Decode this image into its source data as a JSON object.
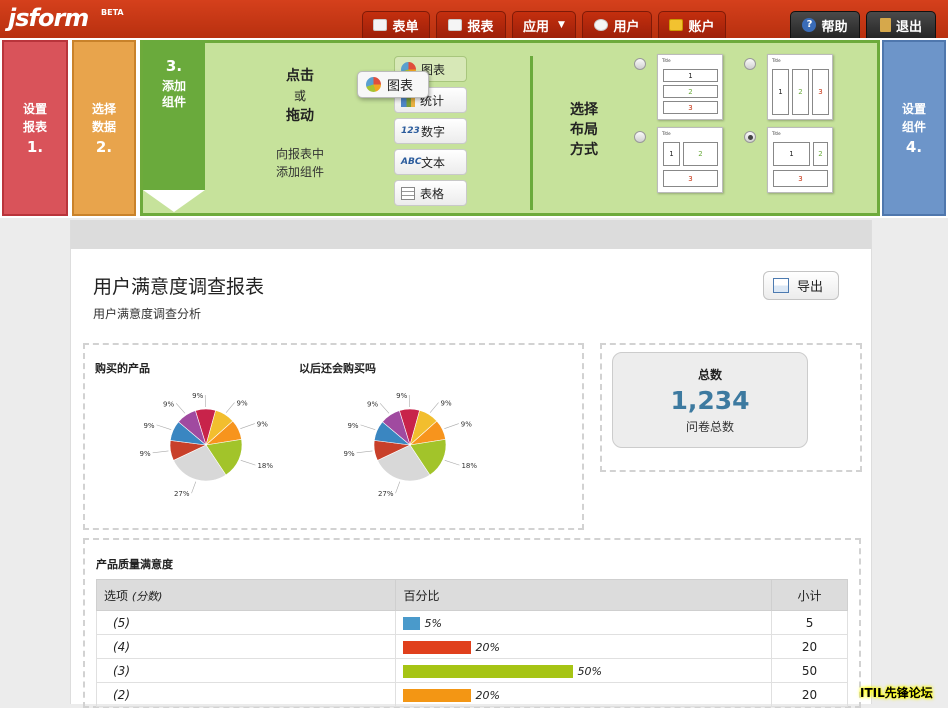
{
  "app": {
    "logo": "jsform",
    "badge": "BETA"
  },
  "nav": {
    "forms": "表单",
    "reports": "报表",
    "apps": "应用",
    "users": "用户",
    "account": "账户",
    "help": "帮助",
    "logout": "退出"
  },
  "steps": {
    "s1": {
      "line1": "设置",
      "line2": "报表",
      "num": "1."
    },
    "s2": {
      "line1": "选择",
      "line2": "数据",
      "num": "2."
    },
    "s3": {
      "num": "3.",
      "line1": "添加",
      "line2": "组件"
    },
    "s4": {
      "line1": "设置",
      "line2": "组件",
      "num": "4."
    }
  },
  "builder": {
    "click": "点击",
    "or": "或",
    "drag": "拖动",
    "add_line1": "向报表中",
    "add_line2": "添加组件",
    "components": [
      {
        "label": "图表",
        "icon": "pie-chart-icon"
      },
      {
        "label": "统计",
        "icon": "bar-stats-icon"
      },
      {
        "label": "数字",
        "icon": "number-icon",
        "glyph": "123"
      },
      {
        "label": "文本",
        "icon": "text-icon",
        "glyph": "ABC"
      },
      {
        "label": "表格",
        "icon": "table-icon"
      }
    ],
    "dragging": "图表",
    "layout_title": {
      "l1": "选择",
      "l2": "布局",
      "l3": "方式"
    },
    "layout_box_title": "Title",
    "layout_nums": {
      "n1": "1",
      "n2": "2",
      "n3": "3"
    }
  },
  "report": {
    "title": "用户满意度调查报表",
    "subtitle": "用户满意度调查分析",
    "export": "导出"
  },
  "total": {
    "label": "总数",
    "value": "1,234",
    "sub": "问卷总数"
  },
  "chart_data": [
    {
      "type": "pie",
      "title": "购买的产品",
      "labels": [
        "9%",
        "9%",
        "9%",
        "18%",
        "27%",
        "9%",
        "9%",
        "9%"
      ],
      "values": [
        9,
        9,
        9,
        18,
        27,
        9,
        9,
        9
      ],
      "colors": [
        "#c8234a",
        "#f2be2e",
        "#f7941d",
        "#f7941d",
        "#a2c42a",
        "#d0d0d0",
        "#c8402a",
        "#3a86c1",
        "#a04aa0"
      ]
    },
    {
      "type": "pie",
      "title": "以后还会购买吗",
      "labels": [
        "9%",
        "9%",
        "9%",
        "18%",
        "27%",
        "9%",
        "9%",
        "9%"
      ],
      "values": [
        9,
        9,
        9,
        18,
        27,
        9,
        9,
        9
      ]
    },
    {
      "type": "table",
      "title": "产品质量满意度",
      "columns": [
        "选项",
        "(分数)",
        "百分比",
        "小计"
      ],
      "rows": [
        {
          "option": "(5)",
          "pct": "5%",
          "value": 5,
          "count": "5",
          "color": "#4a9acb"
        },
        {
          "option": "(4)",
          "pct": "20%",
          "value": 20,
          "count": "20",
          "color": "#e0401c"
        },
        {
          "option": "(3)",
          "pct": "50%",
          "value": 50,
          "count": "50",
          "color": "#a6c414"
        },
        {
          "option": "(2)",
          "pct": "20%",
          "value": 20,
          "count": "20",
          "color": "#f39614"
        }
      ]
    }
  ],
  "watermark": "ITIL先锋论坛"
}
